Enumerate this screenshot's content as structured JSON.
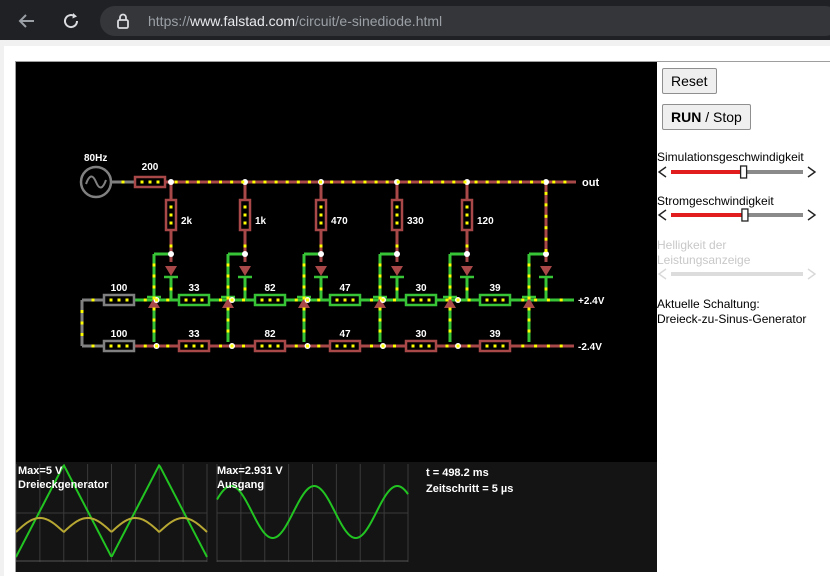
{
  "browser": {
    "url_prefix": "https://",
    "url_domain": "www.falstad.com",
    "url_path": "/circuit/e-sinediode.html"
  },
  "controls": {
    "reset_label": "Reset",
    "run_label": "RUN",
    "run_sep": " / ",
    "stop_label": "Stop",
    "sim_speed_label": "Simulationsgeschwindigkeit",
    "current_speed_label": "Stromgeschwindigkeit",
    "brightness_label": "Helligkeit der Leistungsanzeige",
    "sim_speed_level": 0.55,
    "current_speed_level": 0.56,
    "brightness_level": 0.0,
    "circuit_heading": "Aktuelle Schaltung:",
    "circuit_name": "Dreieck-zu-Sinus-Generator"
  },
  "circuit": {
    "source_freq": "80Hz",
    "source_resistor": "200",
    "out_label": "out",
    "plus_label": "+2.4V",
    "minus_label": "-2.4V",
    "vertical_resistors": [
      "2k",
      "1k",
      "470",
      "330",
      "120"
    ],
    "top_row_resistors": [
      "100",
      "33",
      "82",
      "47",
      "30",
      "39"
    ],
    "bottom_row_resistors": [
      "100",
      "33",
      "82",
      "47",
      "30",
      "39"
    ]
  },
  "scopes": [
    {
      "max": "Max=5 V",
      "name": "Dreieckgenerator"
    },
    {
      "max": "Max=2.931 V",
      "name": "Ausgang"
    }
  ],
  "status": {
    "time": "t = 498.2 ms",
    "step": "Zeitschritt = 5 µs"
  },
  "colors": {
    "wire_red": "#a84848",
    "wire_green": "#37c437",
    "wire_gray": "#808080",
    "current_dot": "#ffff00",
    "slider_red": "#e21d1d"
  }
}
